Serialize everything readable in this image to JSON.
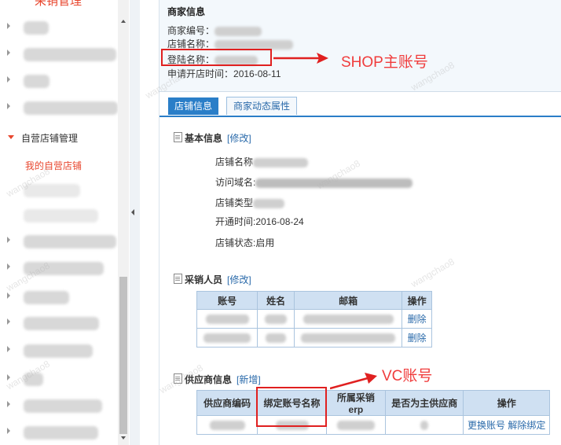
{
  "sidebar": {
    "top_title": "采销管理",
    "expanded_item": "自营店铺管理",
    "active_subitem": "我的自营店铺"
  },
  "merchant": {
    "title": "商家信息",
    "merchant_no_label": "商家编号：",
    "shop_name_label": "店铺名称：",
    "login_name_label": "登陆名称：",
    "open_time_label": "申请开店时间：",
    "open_time_value": "2016-08-11"
  },
  "annotations": {
    "shop_account": "SHOP主账号",
    "vc_account": "VC账号"
  },
  "tabs": [
    {
      "label": "店铺信息",
      "active": true
    },
    {
      "label": "商家动态属性",
      "active": false
    }
  ],
  "basic_info": {
    "title": "基本信息",
    "edit": "[修改]",
    "shop_name_label": "店铺名称",
    "domain_label": "访问域名:",
    "shop_type_label": "店铺类型",
    "open_time": "开通时间:2016-08-24",
    "status": "店铺状态:启用"
  },
  "buyers": {
    "title": "采销人员",
    "edit": "[修改]",
    "columns": [
      "账号",
      "姓名",
      "邮箱",
      "操作"
    ],
    "rows": [
      {
        "action": "删除"
      },
      {
        "action": "删除"
      }
    ]
  },
  "suppliers": {
    "title": "供应商信息",
    "add": "[新增]",
    "columns": [
      "供应商编码",
      "绑定账号名称",
      "所属采销erp",
      "是否为主供应商",
      "操作"
    ],
    "row": {
      "action_change": "更换账号",
      "action_unbind": "解除绑定"
    }
  },
  "watermark": "wangchao8",
  "colors": {
    "accent": "#2a7ec8",
    "annotation_red": "#e02020",
    "sidebar_active": "#e8472f"
  }
}
